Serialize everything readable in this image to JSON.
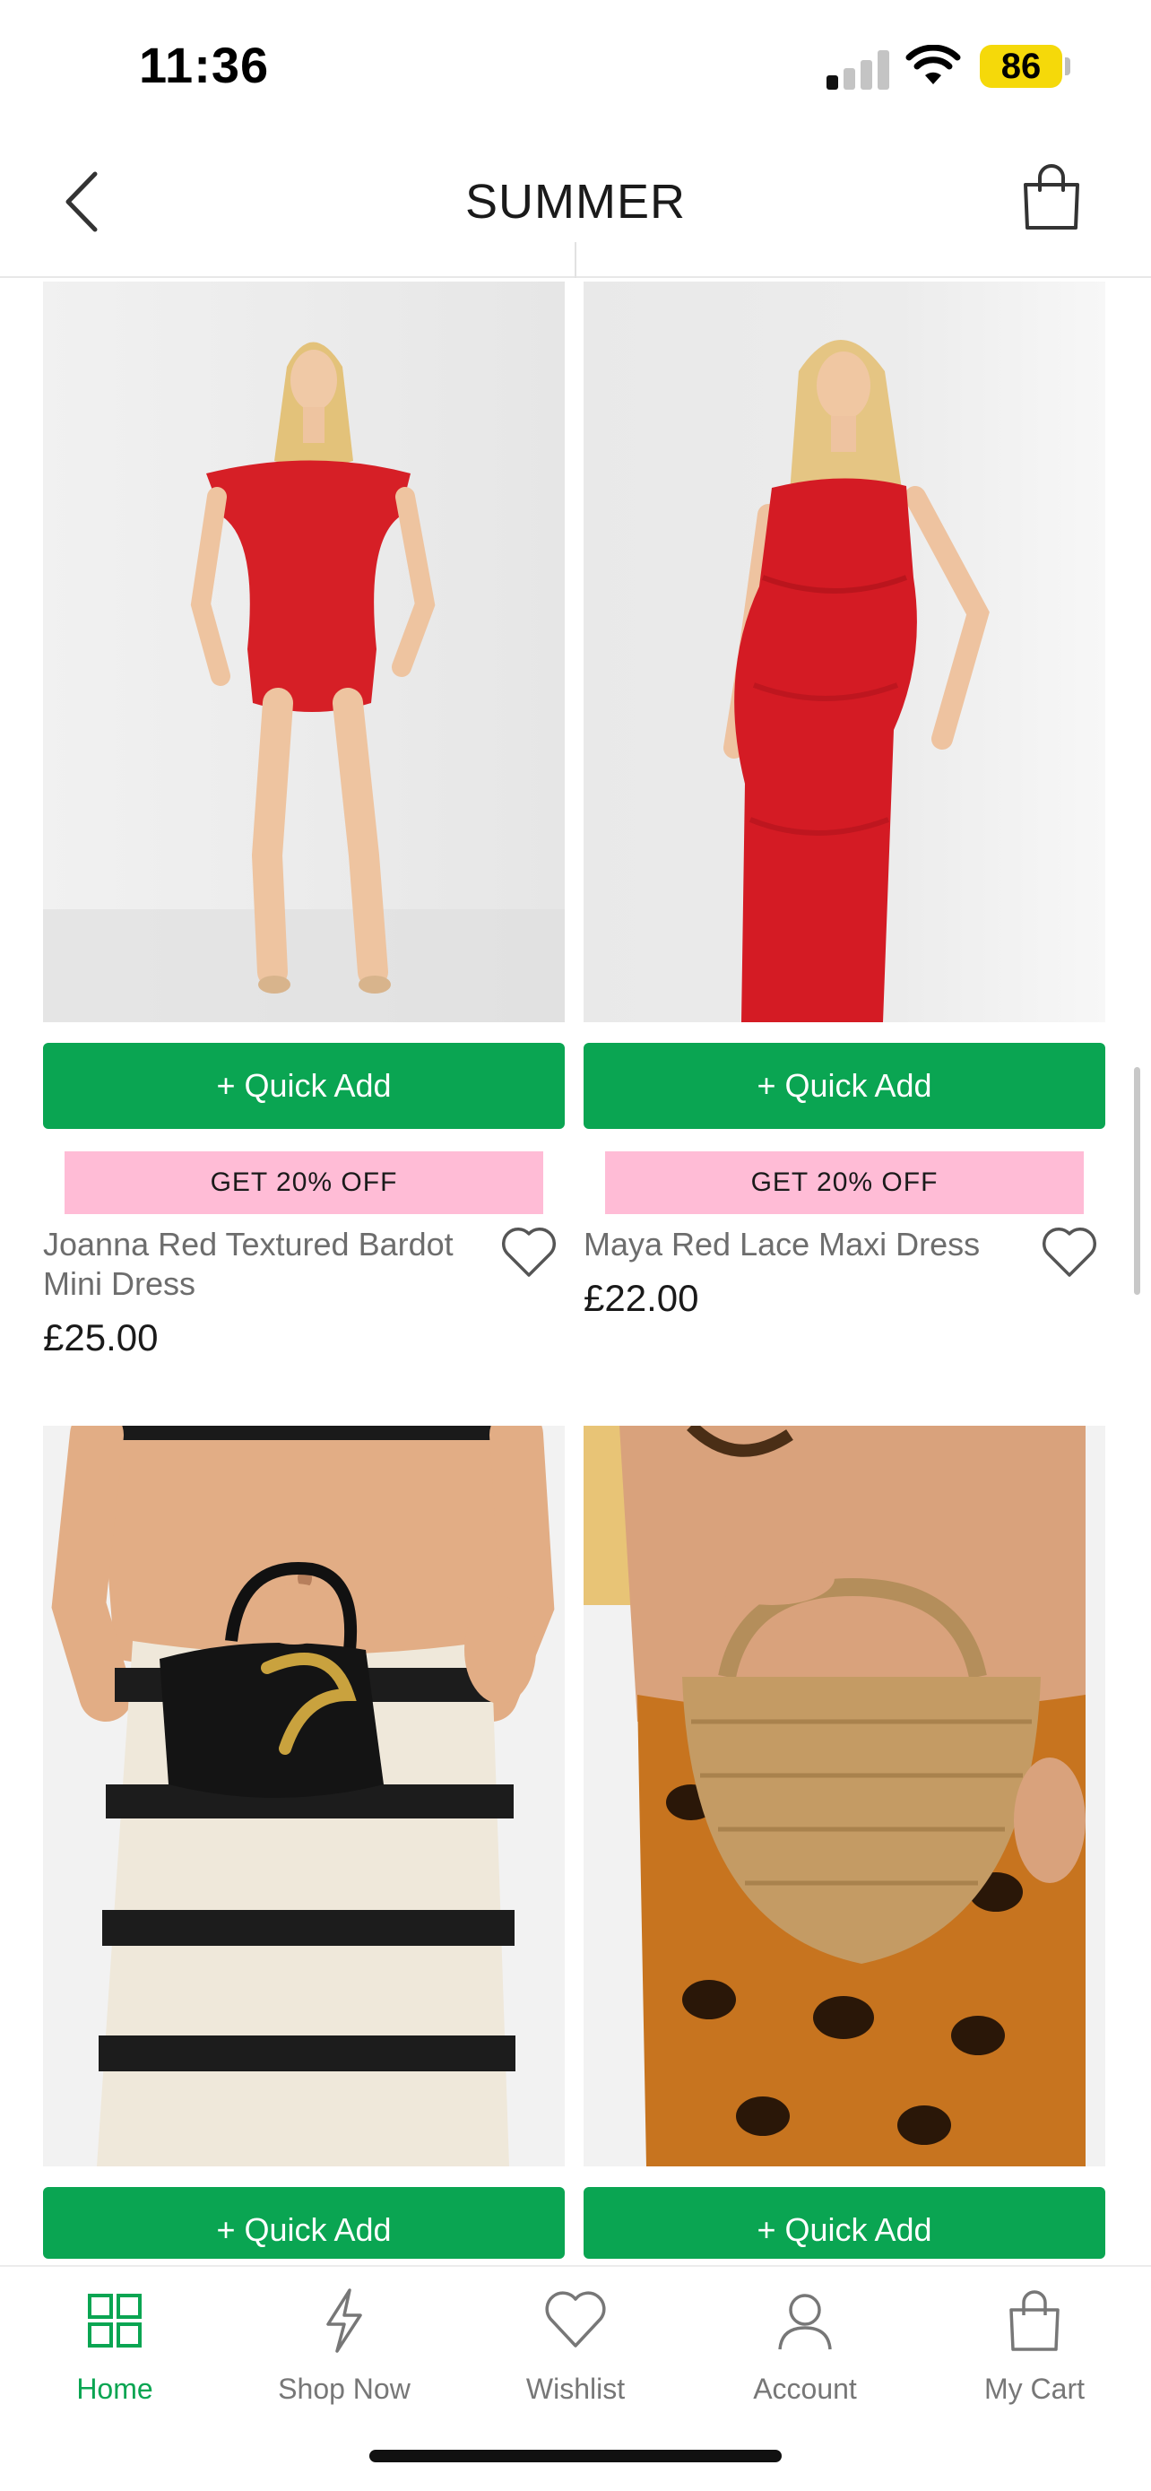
{
  "status_bar": {
    "time": "11:36",
    "battery": "86",
    "icons": [
      "signal-icon",
      "wifi-icon",
      "battery-icon"
    ]
  },
  "header": {
    "title": "SUMMER",
    "back_icon": "chevron-left-icon",
    "bag_icon": "shopping-bag-icon"
  },
  "products": [
    {
      "name": "Joanna Red Textured Bardot Mini Dress",
      "price": "£25.00",
      "quick_add": "+ Quick Add",
      "promo": "GET 20% OFF"
    },
    {
      "name": "Maya Red Lace Maxi Dress",
      "price": "£22.00",
      "quick_add": "+ Quick Add",
      "promo": "GET 20% OFF"
    },
    {
      "quick_add": "+ Quick Add"
    },
    {
      "quick_add": "+ Quick Add"
    }
  ],
  "tabs": [
    {
      "label": "Home",
      "icon": "grid-icon",
      "active": true
    },
    {
      "label": "Shop Now",
      "icon": "lightning-icon",
      "active": false
    },
    {
      "label": "Wishlist",
      "icon": "heart-icon",
      "active": false
    },
    {
      "label": "Account",
      "icon": "user-icon",
      "active": false
    },
    {
      "label": "My Cart",
      "icon": "shopping-bag-icon",
      "active": false
    }
  ],
  "colors": {
    "accent_green": "#0aa552",
    "promo_pink": "#ffbcd6",
    "battery_yellow": "#f5d90a"
  }
}
